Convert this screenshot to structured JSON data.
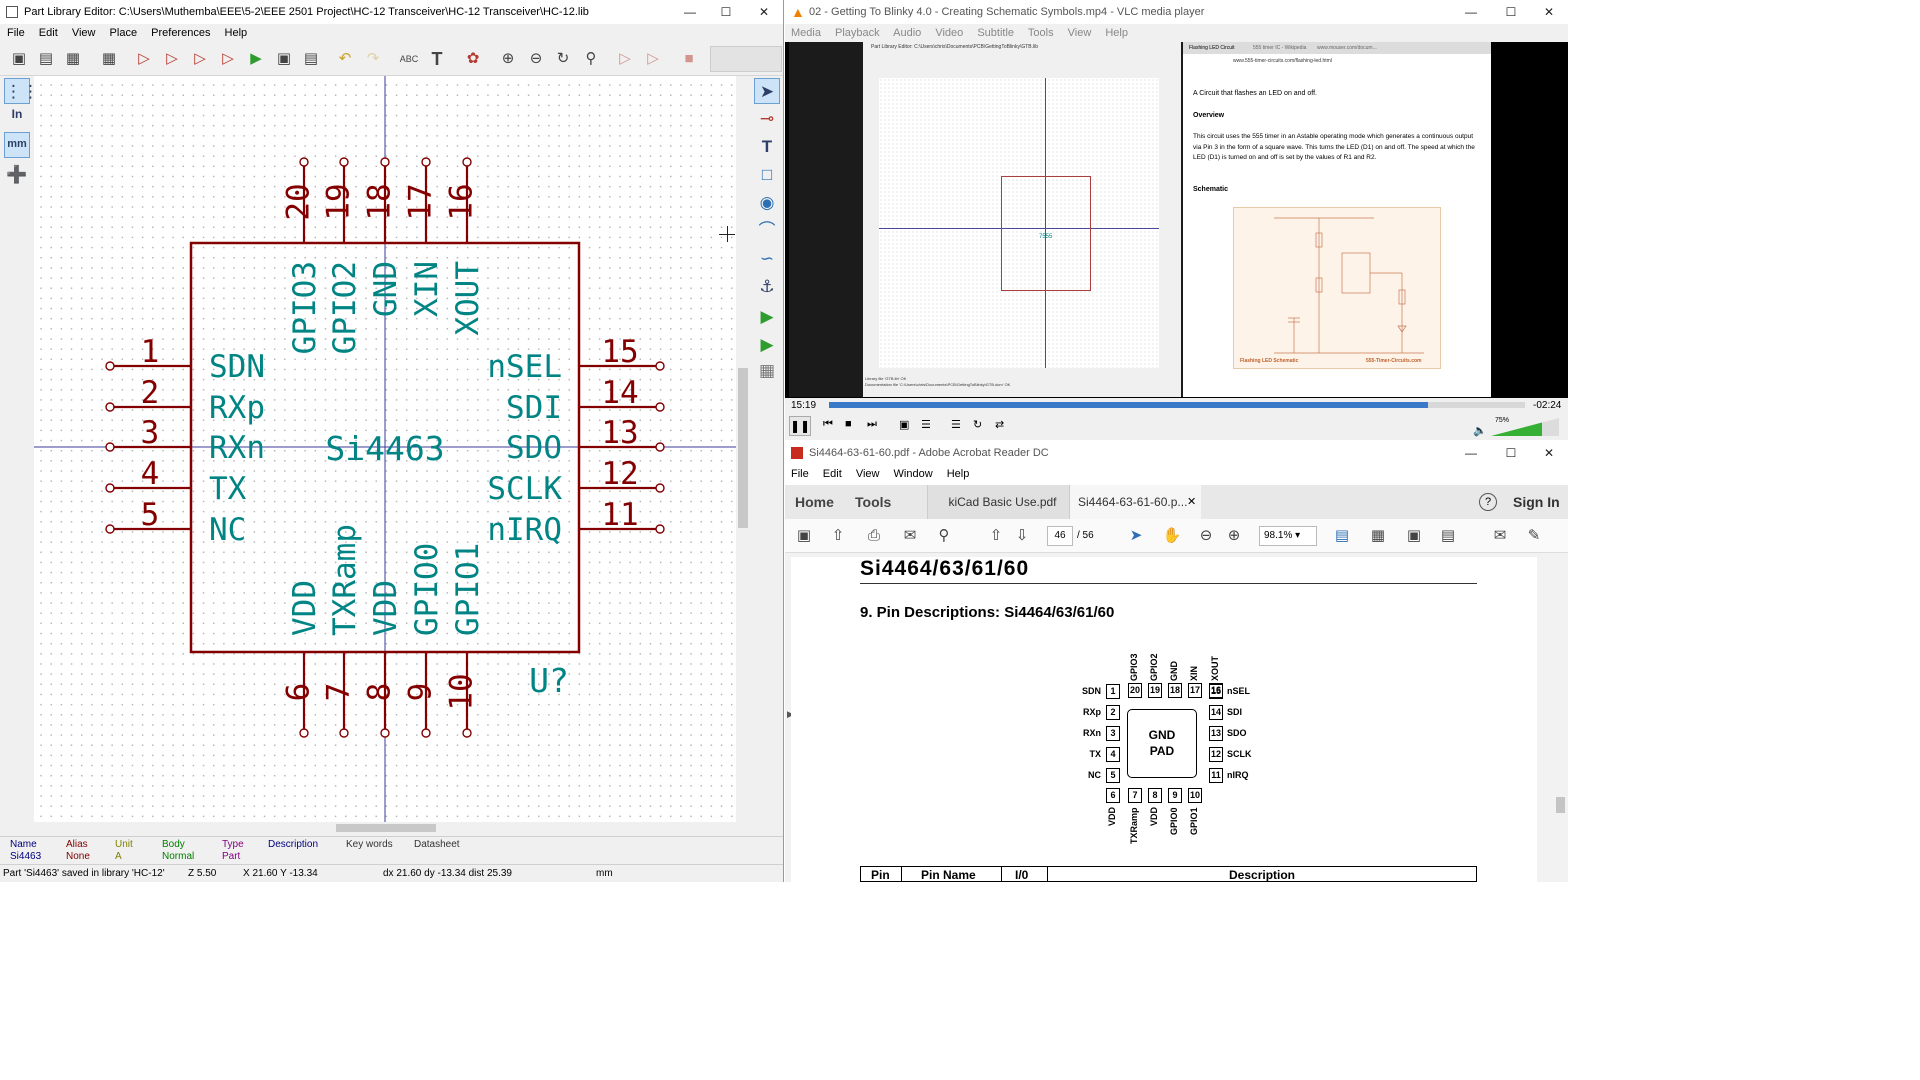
{
  "kicad": {
    "title": "Part Library Editor: C:\\Users\\Muthemba\\EEE\\5-2\\EEE 2501 Project\\HC-12 Transceiver\\HC-12 Transceiver\\HC-12.lib",
    "menu": [
      "File",
      "Edit",
      "View",
      "Place",
      "Preferences",
      "Help"
    ],
    "left_tools": {
      "inches": "In",
      "mm": "mm"
    },
    "component": {
      "name": "Si4463",
      "reference": "U?",
      "left_pins": [
        {
          "num": "1",
          "name": "SDN"
        },
        {
          "num": "2",
          "name": "RXp"
        },
        {
          "num": "3",
          "name": "RXn"
        },
        {
          "num": "4",
          "name": "TX"
        },
        {
          "num": "5",
          "name": "NC"
        }
      ],
      "right_pins": [
        {
          "num": "15",
          "name": "nSEL"
        },
        {
          "num": "14",
          "name": "SDI"
        },
        {
          "num": "13",
          "name": "SDO"
        },
        {
          "num": "12",
          "name": "SCLK"
        },
        {
          "num": "11",
          "name": "nIRQ"
        }
      ],
      "top_pins": [
        {
          "num": "20",
          "name": "GPIO3"
        },
        {
          "num": "19",
          "name": "GPIO2"
        },
        {
          "num": "18",
          "name": "GND"
        },
        {
          "num": "17",
          "name": "XIN"
        },
        {
          "num": "16",
          "name": "XOUT"
        }
      ],
      "bottom_pins": [
        {
          "num": "6",
          "name": "VDD"
        },
        {
          "num": "7",
          "name": "TXRamp"
        },
        {
          "num": "8",
          "name": "VDD"
        },
        {
          "num": "9",
          "name": "GPIO0"
        },
        {
          "num": "10",
          "name": "GPIO1"
        }
      ],
      "color": "#840000",
      "text_color": "#008484"
    },
    "info_bar": {
      "headers": [
        "Name",
        "Alias",
        "Unit",
        "Body",
        "Type",
        "Description",
        "Key words",
        "Datasheet"
      ],
      "values": [
        "Si4463",
        "None",
        "A",
        "Normal",
        "Part",
        "",
        "",
        ""
      ]
    },
    "status": {
      "message": "Part 'Si4463' saved in library 'HC-12'",
      "zoom": "Z 5.50",
      "coords": "X 21.60  Y -13.34",
      "delta": "dx 21.60  dy -13.34  dist 25.39",
      "units": "mm"
    }
  },
  "vlc": {
    "title": "02 - Getting To Blinky 4.0 - Creating Schematic Symbols.mp4 - VLC media player",
    "menu": [
      "Media",
      "Playback",
      "Audio",
      "Video",
      "Subtitle",
      "Tools",
      "View",
      "Help"
    ],
    "time_elapsed": "15:19",
    "time_remaining": "-02:24",
    "progress": 0.86,
    "volume": "75%",
    "video": {
      "browser_url": "www.555-timer-circuits.com/flashing-led.html",
      "tab1": "Flashing LED Circuit",
      "tab2": "555 timer IC - Wikipedia",
      "tab3": "www.mouser.com/docum...",
      "intro": "A Circuit that flashes an LED on and off.",
      "overview_heading": "Overview",
      "overview_text": "This circuit uses the 555 timer in an Astable operating mode which generates a continuous output via Pin 3 in the form of a square wave. This turns the LED (D1) on and off. The speed at which the LED (D1) is turned on and off is set by the values of R1 and R2.",
      "schematic_heading": "Schematic",
      "schematic_caption_left": "Flashing LED Schematic",
      "schematic_caption_right": "555-Timer-Circuits.com",
      "kicad_inner_title": "Part Library Editor: C:\\Users\\chris\\Documents\\PCB\\GettingToBlinky\\GTB.lib",
      "inner_status1": "Library file 'GTB.lib' OK",
      "inner_status2": "Documentation file 'C:\\Users\\chris\\Documents\\PCB\\GettingToBlinky\\GTB.dcm' OK",
      "inner_chip": "7555"
    }
  },
  "acrobat": {
    "title": "Si4464-63-61-60.pdf - Adobe Acrobat Reader DC",
    "menu": [
      "File",
      "Edit",
      "View",
      "Window",
      "Help"
    ],
    "tabs": [
      "Home",
      "Tools",
      "kiCad Basic Use.pdf",
      "Si4464-63-61-60.p..."
    ],
    "signin": "Sign In",
    "page_current": "46",
    "page_total": "/ 56",
    "zoom": "98.1%",
    "doc": {
      "header": "Si4464/63/61/60",
      "section": "9.  Pin Descriptions: Si4464/63/61/60",
      "pad_label_1": "GND",
      "pad_label_2": "PAD",
      "left": [
        {
          "n": "1",
          "l": "SDN"
        },
        {
          "n": "2",
          "l": "RXp"
        },
        {
          "n": "3",
          "l": "RXn"
        },
        {
          "n": "4",
          "l": "TX"
        },
        {
          "n": "5",
          "l": "NC"
        }
      ],
      "right": [
        {
          "n": "15",
          "l": "nSEL"
        },
        {
          "n": "14",
          "l": "SDI"
        },
        {
          "n": "13",
          "l": "SDO"
        },
        {
          "n": "12",
          "l": "SCLK"
        },
        {
          "n": "11",
          "l": "nIRQ"
        }
      ],
      "top": [
        {
          "n": "20",
          "l": "GPIO3"
        },
        {
          "n": "19",
          "l": "GPIO2"
        },
        {
          "n": "18",
          "l": "GND"
        },
        {
          "n": "17",
          "l": "XIN"
        },
        {
          "n": "16",
          "l": "XOUT"
        }
      ],
      "bottom": [
        {
          "n": "6",
          "l": "VDD"
        },
        {
          "n": "7",
          "l": "TXRamp"
        },
        {
          "n": "8",
          "l": "VDD"
        },
        {
          "n": "9",
          "l": "GPIO0"
        },
        {
          "n": "10",
          "l": "GPIO1"
        }
      ],
      "table_headers": [
        "Pin",
        "Pin Name",
        "I/0",
        "Description"
      ]
    }
  }
}
